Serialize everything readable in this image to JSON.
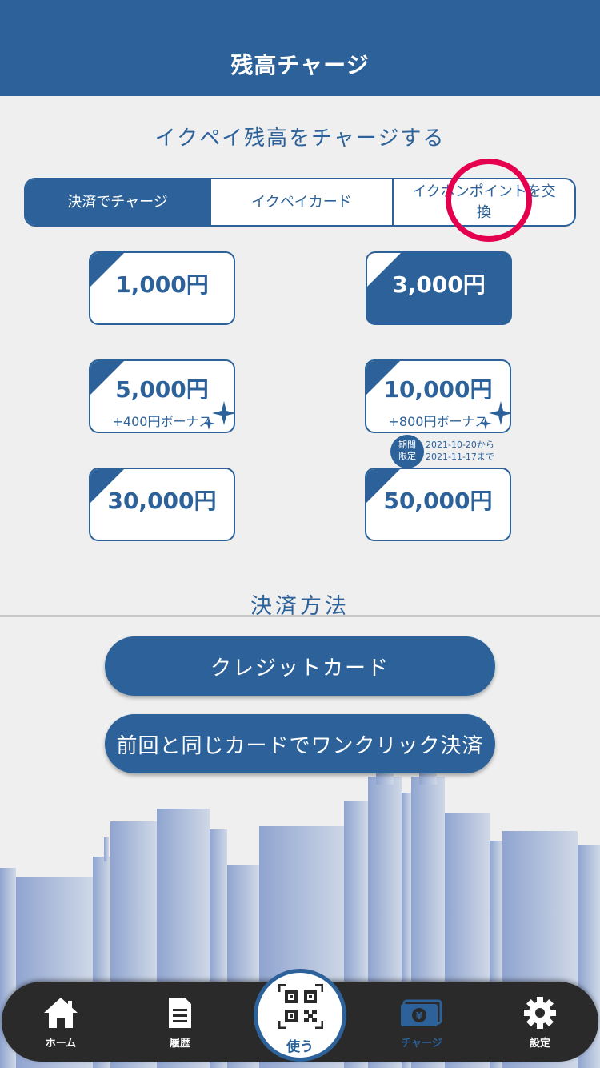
{
  "header": {
    "title": "残高チャージ"
  },
  "subtitle": "イクペイ残高をチャージする",
  "tabs": [
    {
      "label": "決済でチャージ",
      "active": true
    },
    {
      "label": "イクペイカード",
      "active": false
    },
    {
      "label": "イクポンポイントを交換",
      "active": false
    }
  ],
  "amounts": [
    {
      "value": "1,000円",
      "bonus": "",
      "selected": false
    },
    {
      "value": "3,000円",
      "bonus": "",
      "selected": true
    },
    {
      "value": "5,000円",
      "bonus": "+400円ボーナス",
      "selected": false
    },
    {
      "value": "10,000円",
      "bonus": "+800円ボーナス",
      "selected": false
    },
    {
      "value": "30,000円",
      "bonus": "",
      "selected": false
    },
    {
      "value": "50,000円",
      "bonus": "",
      "selected": false
    }
  ],
  "limited": {
    "badge_line1": "期間",
    "badge_line2": "限定",
    "date_from": "2021-10-20から",
    "date_to": "2021-11-17まで"
  },
  "payment": {
    "title": "決済方法",
    "credit_card": "クレジットカード",
    "one_click": "前回と同じカードでワンクリック決済"
  },
  "nav": {
    "home": "ホーム",
    "history": "履歴",
    "use": "使う",
    "charge": "チャージ",
    "settings": "設定"
  },
  "colors": {
    "brand": "#2c6299",
    "highlight_circle": "#e5004f",
    "nav_bg": "#2a2a2a"
  }
}
